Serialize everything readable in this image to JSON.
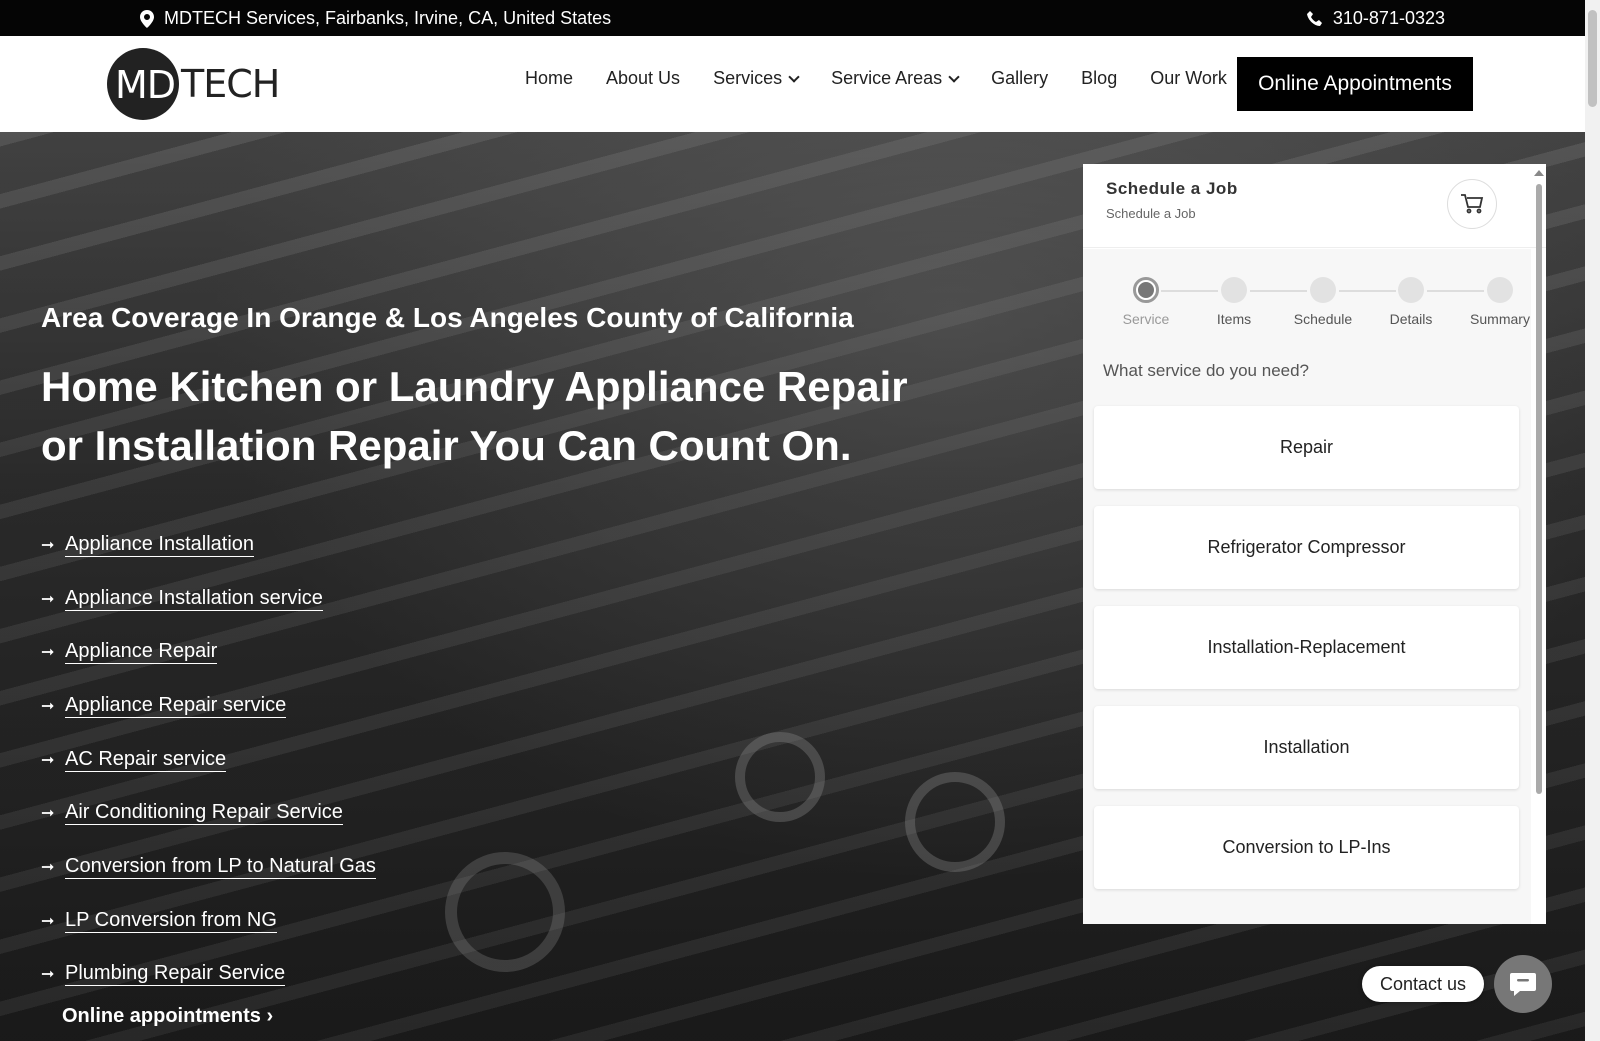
{
  "topbar": {
    "address": "MDTECH Services, Fairbanks, Irvine, CA, United States",
    "phone": "310-871-0323"
  },
  "logo": {
    "md": "MD",
    "tech": "TECH"
  },
  "nav": {
    "items": [
      {
        "label": "Home"
      },
      {
        "label": "About Us"
      },
      {
        "label": "Services"
      },
      {
        "label": "Service Areas"
      },
      {
        "label": "Gallery"
      },
      {
        "label": "Blog"
      },
      {
        "label": "Our Work"
      }
    ],
    "cta": "Online Appointments"
  },
  "hero": {
    "subtitle": "Area Coverage In Orange & Los Angeles County of California",
    "title": "Home Kitchen or Laundry Appliance Repair or Installation Repair You Can Count On.",
    "services": [
      "Appliance Installation",
      "Appliance Installation service",
      "Appliance Repair",
      "Appliance Repair service",
      "AC Repair service",
      "Air Conditioning Repair Service",
      "Conversion from LP to Natural Gas",
      "LP Conversion from NG",
      "Plumbing Repair Service"
    ],
    "online_link": "Online appointments"
  },
  "widget": {
    "title": "Schedule a Job",
    "subtitle": "Schedule a Job",
    "steps": [
      "Service",
      "Items",
      "Schedule",
      "Details",
      "Summary"
    ],
    "question": "What service do you need?",
    "options": [
      "Repair",
      "Refrigerator Compressor",
      "Installation-Replacement",
      "Installation",
      "Conversion to LP-Ins"
    ]
  },
  "contact": {
    "label": "Contact us"
  }
}
